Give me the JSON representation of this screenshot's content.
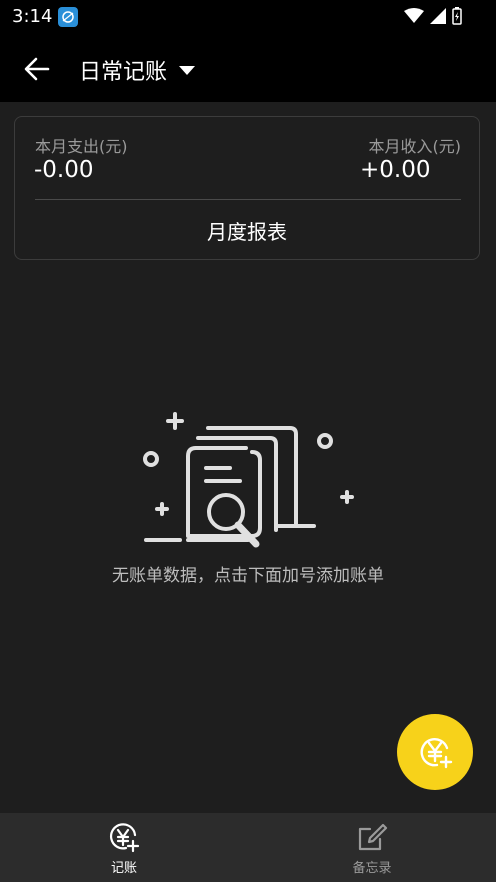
{
  "status_bar": {
    "time": "3:14"
  },
  "app_bar": {
    "book_title": "日常记账"
  },
  "summary": {
    "expense_label": "本月支出(元)",
    "expense_value": "-0.00",
    "income_label": "本月收入(元)",
    "income_value": "+0.00",
    "report_label": "月度报表"
  },
  "empty_state": {
    "message": "无账单数据，点击下面加号添加账单"
  },
  "fab": {
    "icon": "yen-add-icon"
  },
  "bottom_nav": {
    "items": [
      {
        "label": "记账",
        "icon": "yen-add-icon",
        "active": true
      },
      {
        "label": "备忘录",
        "icon": "edit-note-icon",
        "active": false
      }
    ]
  },
  "colors": {
    "background": "#1e1e1e",
    "app_bar": "#000000",
    "accent": "#f7d21a",
    "card_border": "#3c3c3c",
    "nav_bar": "#2c2c2c"
  }
}
